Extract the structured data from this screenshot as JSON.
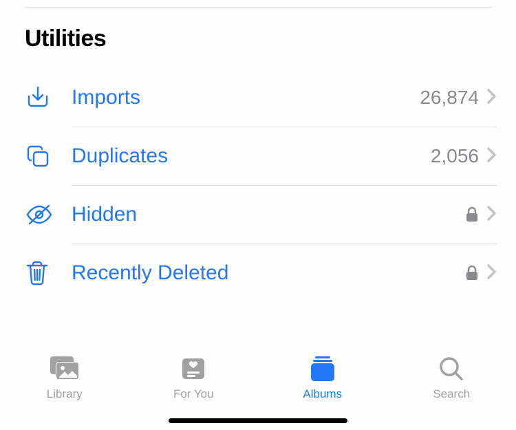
{
  "section_title": "Utilities",
  "rows": {
    "imports": {
      "label": "Imports",
      "count": "26,874",
      "locked": false
    },
    "dupes": {
      "label": "Duplicates",
      "count": "2,056",
      "locked": false
    },
    "hidden": {
      "label": "Hidden",
      "count": "",
      "locked": true
    },
    "deleted": {
      "label": "Recently Deleted",
      "count": "",
      "locked": true
    }
  },
  "tabs": {
    "library": {
      "label": "Library",
      "active": false
    },
    "foryou": {
      "label": "For You",
      "active": false
    },
    "albums": {
      "label": "Albums",
      "active": true
    },
    "search": {
      "label": "Search",
      "active": false
    }
  },
  "colors": {
    "accent": "#2377f3",
    "inactive": "#a1a1a1",
    "secondary": "#8a8a8e"
  }
}
